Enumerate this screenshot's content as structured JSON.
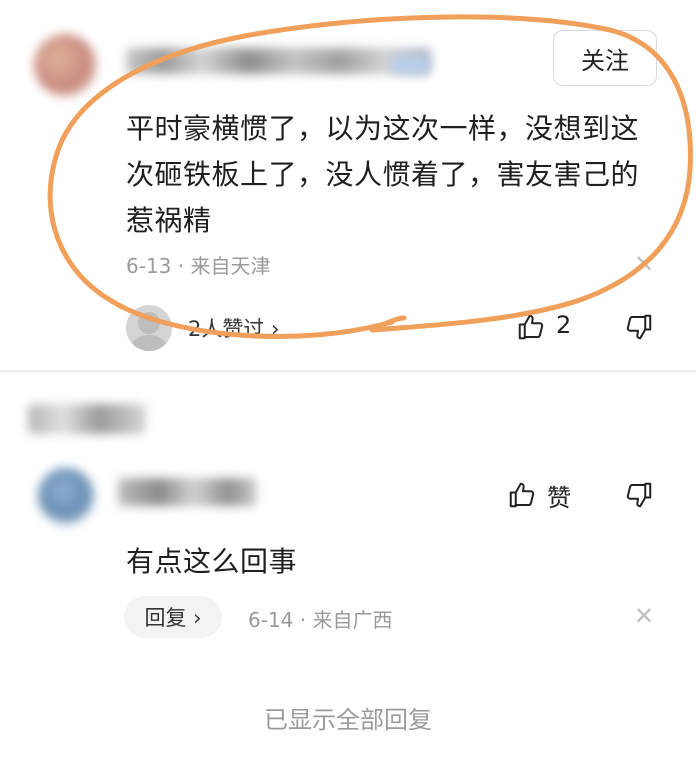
{
  "first_comment": {
    "follow_label": "关注",
    "text": "平时豪横惯了，以为这次一样，没想到这次砸铁板上了，没人惯着了，害友害己的惹祸精",
    "date": "6-13",
    "location": "来自天津",
    "likers_text": "2人赞过 ›",
    "like_count": "2"
  },
  "reply": {
    "text": "有点这么回事",
    "like_label": "赞",
    "reply_label": "回复 ›",
    "date": "6-14",
    "location": "来自广西"
  },
  "footer": {
    "text": "已显示全部回复"
  },
  "colors": {
    "annotation": "#f0a05a",
    "meta_gray": "#9a9a9a"
  },
  "icons": [
    "thumbs-up-icon",
    "thumbs-down-icon",
    "close-icon"
  ]
}
